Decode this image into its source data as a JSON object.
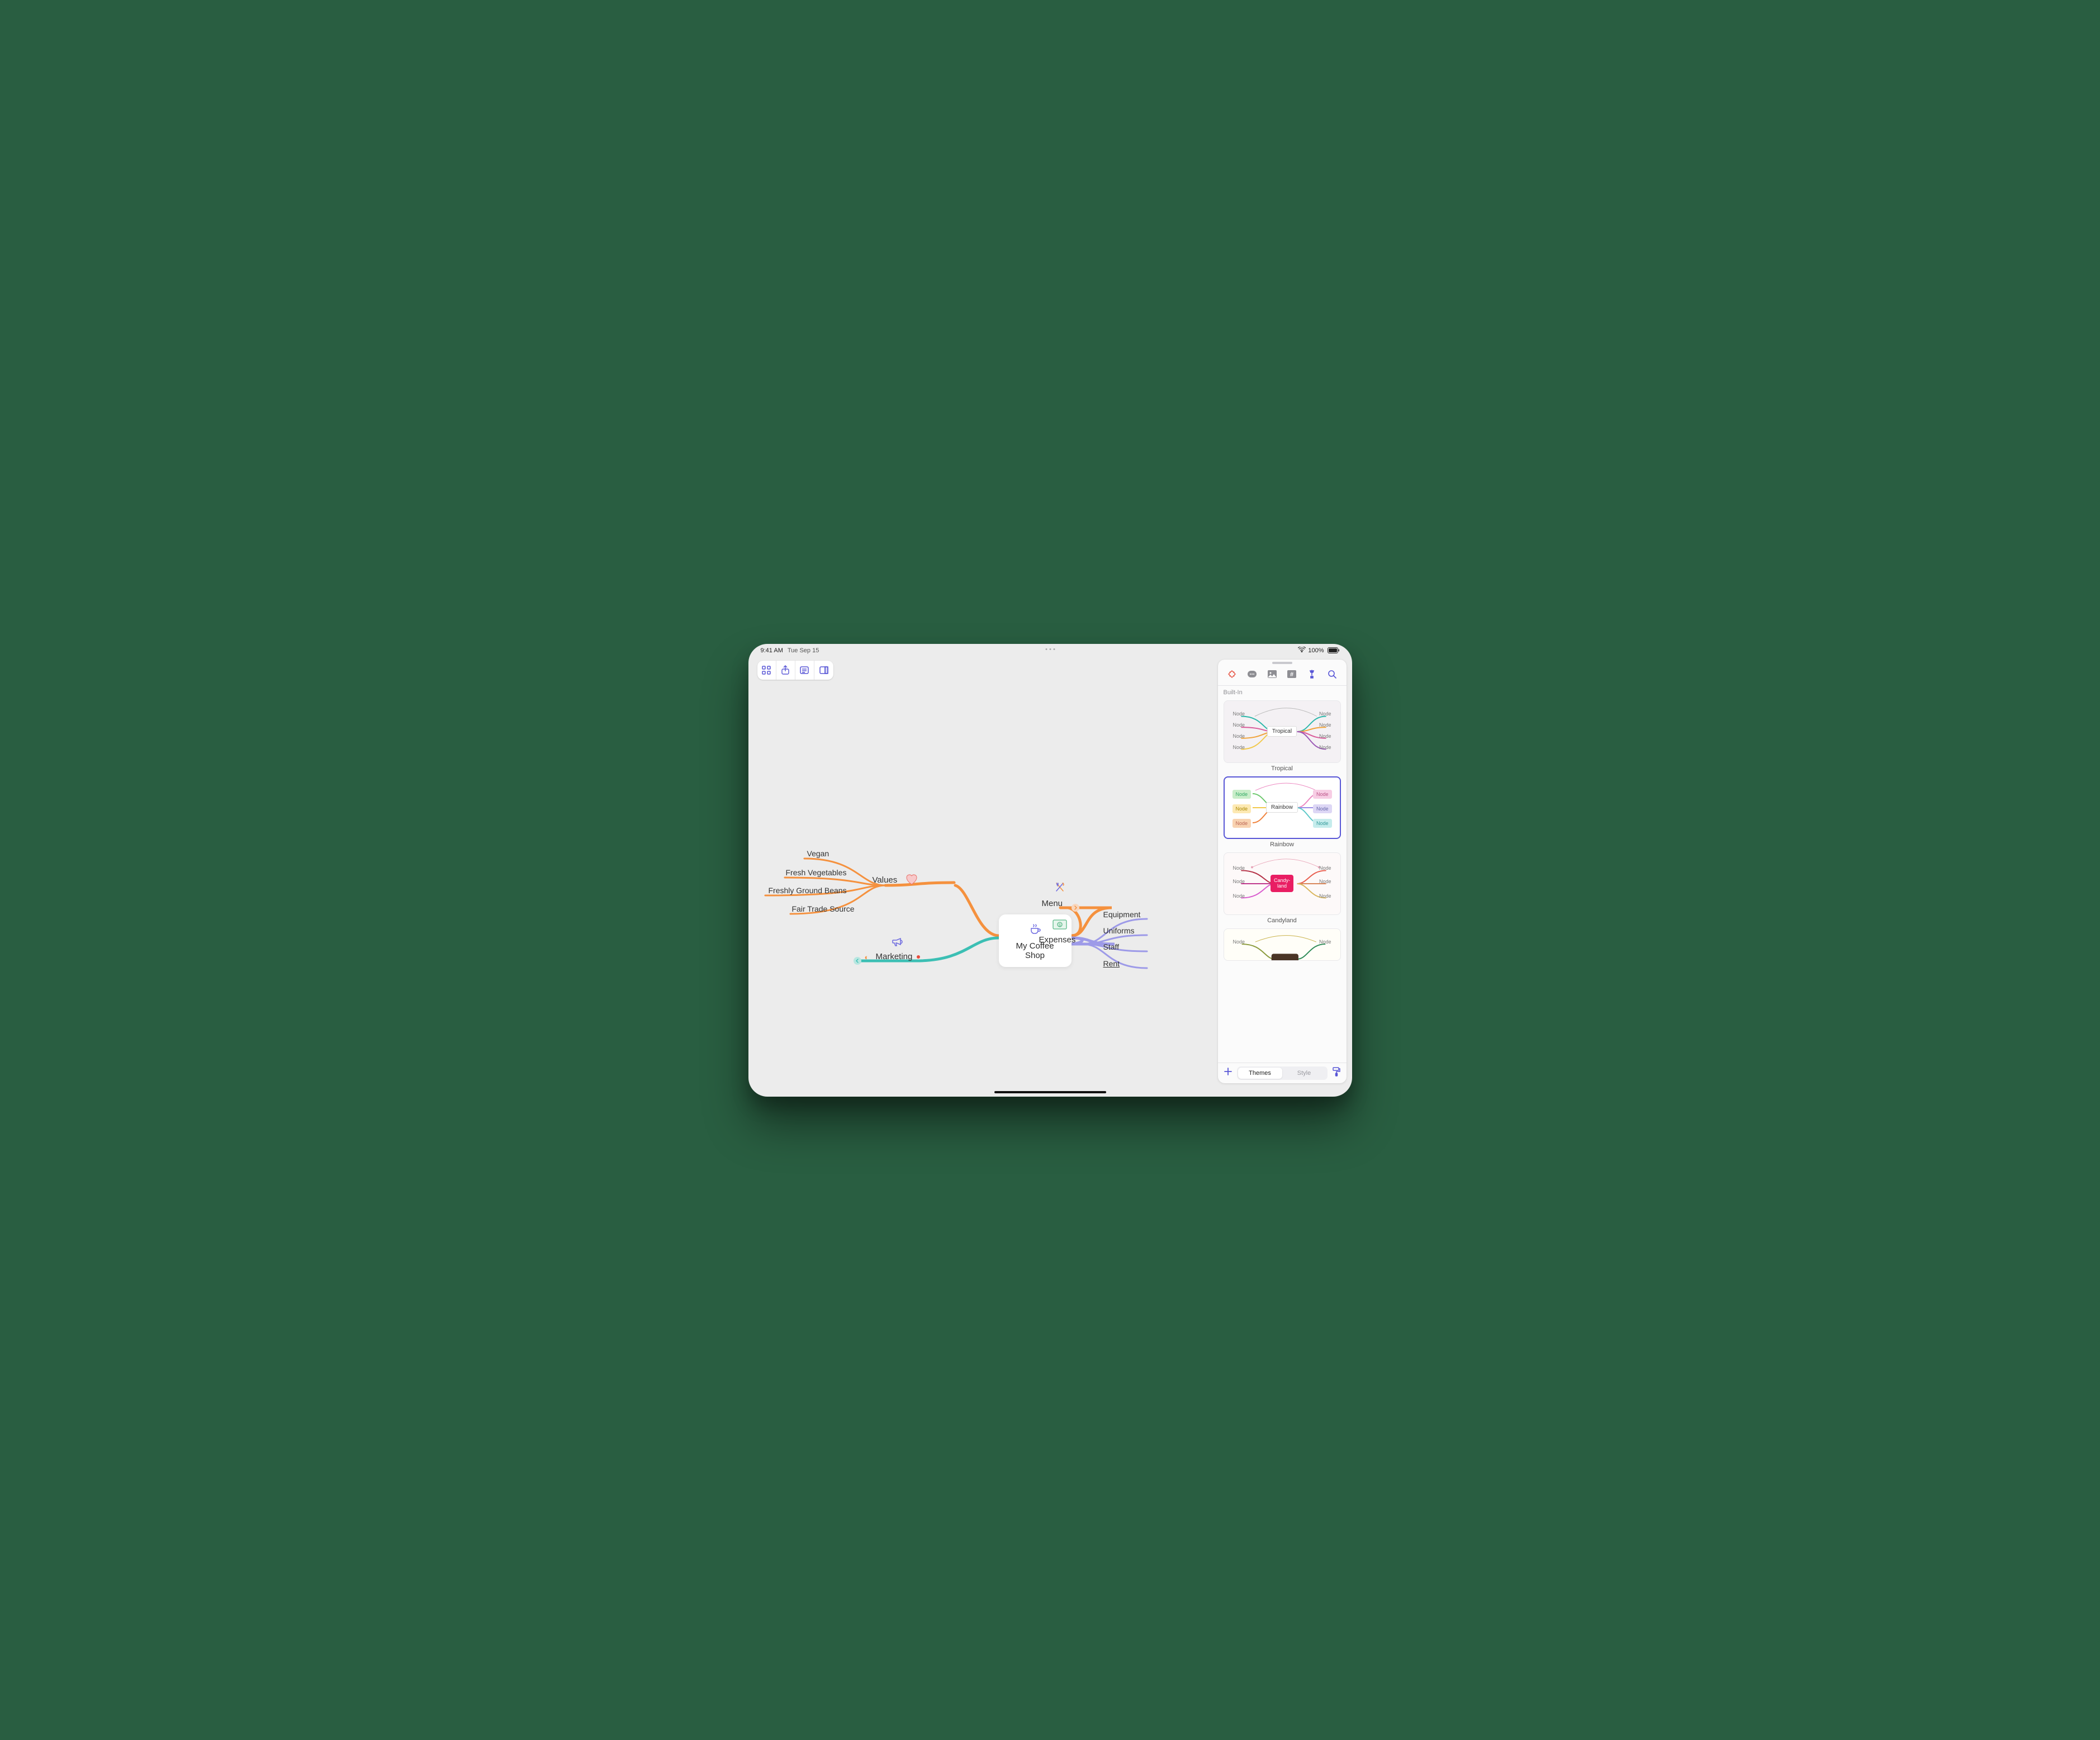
{
  "statusbar": {
    "time": "9:41 AM",
    "date": "Tue Sep 15",
    "battery": "100%"
  },
  "mindmap": {
    "central": "My Coffee Shop",
    "values": {
      "label": "Values",
      "items": [
        "Vegan",
        "Fresh Vegetables",
        "Freshly Ground Beans",
        "Fair Trade Source"
      ]
    },
    "marketing": {
      "label": "Marketing"
    },
    "menu": {
      "label": "Menu"
    },
    "expenses": {
      "label": "Expenses",
      "items": [
        "Equipment",
        "Uniforms",
        "Staff",
        "Rent"
      ]
    }
  },
  "sidebar": {
    "section": "Built-In",
    "themes": [
      {
        "name": "Tropical",
        "nodeLabel": "Node"
      },
      {
        "name": "Rainbow",
        "nodeLabel": "Node"
      },
      {
        "name": "Candyland",
        "center": "Candy-\nland",
        "nodeLabel": "Node"
      },
      {
        "name": "",
        "nodeLabel": "Node"
      }
    ],
    "footer": {
      "themes": "Themes",
      "style": "Style"
    }
  }
}
